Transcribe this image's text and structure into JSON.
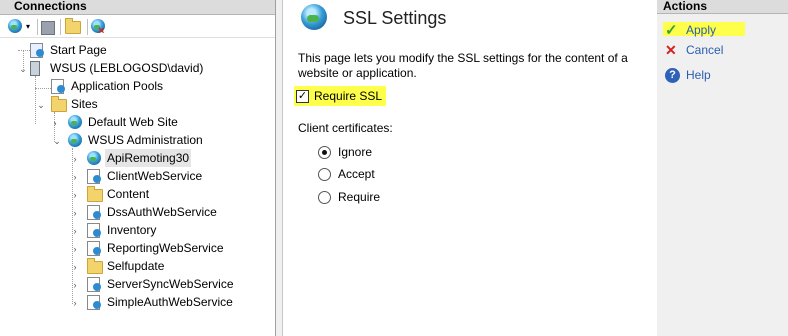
{
  "connections": {
    "header": "Connections",
    "tree": [
      {
        "label": "Start Page",
        "icon": "start-page-icon"
      },
      {
        "label": "WSUS (LEBLOGOSD\\david)",
        "icon": "server-icon"
      },
      {
        "label": "Application Pools",
        "icon": "app-pools-icon"
      },
      {
        "label": "Sites",
        "icon": "folder-icon"
      },
      {
        "label": "Default Web Site",
        "icon": "globe-icon"
      },
      {
        "label": "WSUS Administration",
        "icon": "globe-icon"
      },
      {
        "label": "ApiRemoting30",
        "icon": "globe-icon",
        "selected": true
      },
      {
        "label": "ClientWebService",
        "icon": "web-app-icon"
      },
      {
        "label": "Content",
        "icon": "folder-icon"
      },
      {
        "label": "DssAuthWebService",
        "icon": "web-app-icon"
      },
      {
        "label": "Inventory",
        "icon": "web-app-icon"
      },
      {
        "label": "ReportingWebService",
        "icon": "web-app-icon"
      },
      {
        "label": "Selfupdate",
        "icon": "folder-icon"
      },
      {
        "label": "ServerSyncWebService",
        "icon": "web-app-icon"
      },
      {
        "label": "SimpleAuthWebService",
        "icon": "web-app-icon"
      }
    ]
  },
  "main": {
    "title": "SSL Settings",
    "description": "This page lets you modify the SSL settings for the content of a website or application.",
    "require_ssl_label": "Require SSL",
    "require_ssl_checked": true,
    "client_certs_label": "Client certificates:",
    "radio_options": [
      {
        "label": "Ignore",
        "selected": true
      },
      {
        "label": "Accept",
        "selected": false
      },
      {
        "label": "Require",
        "selected": false
      }
    ]
  },
  "actions": {
    "header": "Actions",
    "items": [
      {
        "label": "Apply",
        "icon": "apply-check-icon"
      },
      {
        "label": "Cancel",
        "icon": "cancel-x-icon"
      },
      {
        "label": "Help",
        "icon": "help-icon"
      }
    ]
  },
  "colors": {
    "highlight": "#fdff4a",
    "link": "#2a5db0"
  }
}
